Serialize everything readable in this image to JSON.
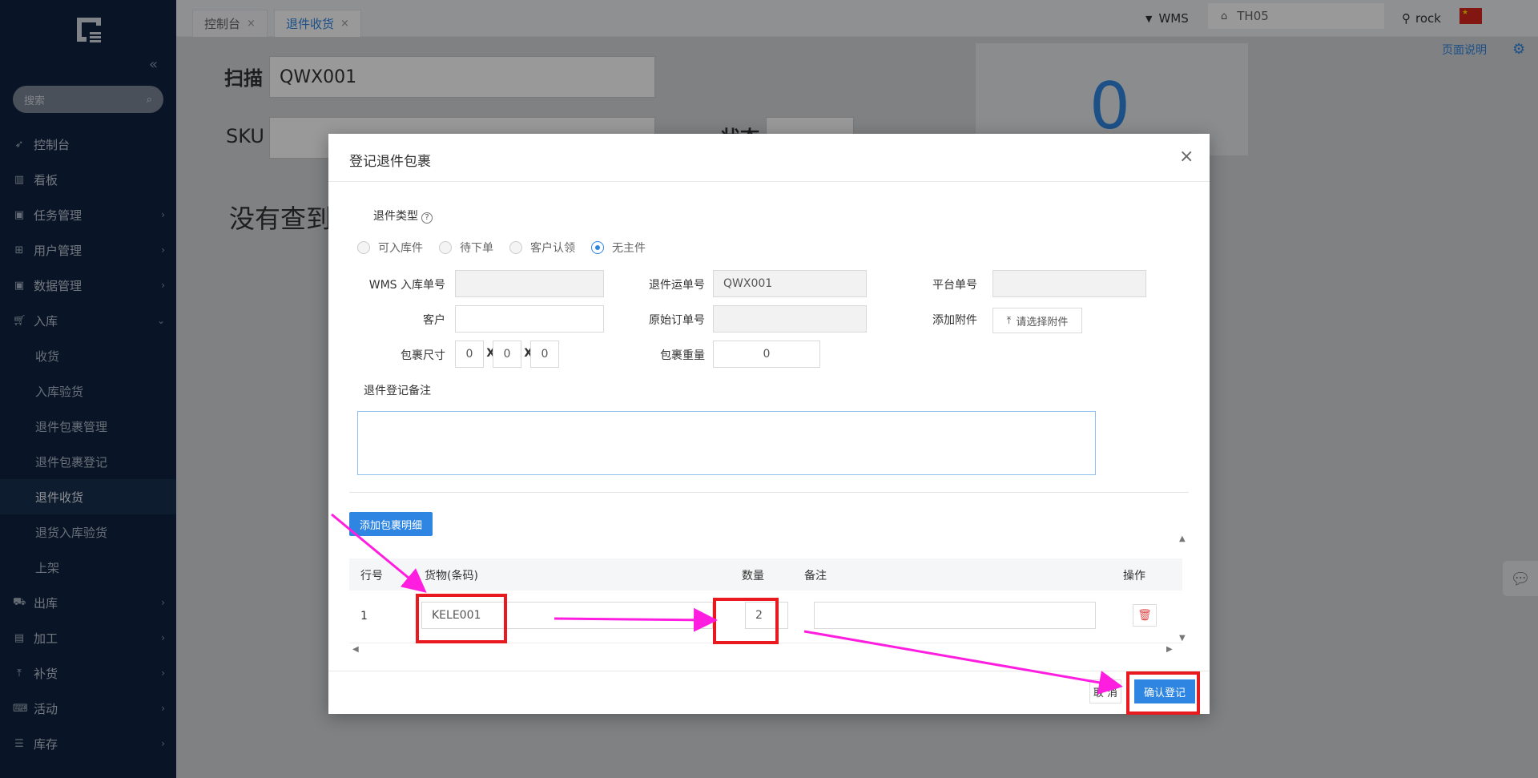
{
  "sidebar": {
    "search_placeholder": "搜索",
    "items": [
      {
        "label": "控制台"
      },
      {
        "label": "看板"
      },
      {
        "label": "任务管理"
      },
      {
        "label": "用户管理"
      },
      {
        "label": "数据管理"
      },
      {
        "label": "入库"
      },
      {
        "label": "出库"
      },
      {
        "label": "加工"
      },
      {
        "label": "补货"
      },
      {
        "label": "活动"
      },
      {
        "label": "库存"
      }
    ],
    "inbound_sub": [
      {
        "label": "收货"
      },
      {
        "label": "入库验货"
      },
      {
        "label": "退件包裹管理"
      },
      {
        "label": "退件包裹登记"
      },
      {
        "label": "退件收货"
      },
      {
        "label": "退货入库验货"
      },
      {
        "label": "上架"
      }
    ]
  },
  "tabs": [
    {
      "label": "控制台",
      "close": "×"
    },
    {
      "label": "退件收货",
      "close": "×"
    }
  ],
  "topbar": {
    "system": "WMS",
    "warehouse": "TH05",
    "user": "rock",
    "flag_star": "★"
  },
  "page": {
    "help_link": "页面说明",
    "scan_label": "扫描",
    "scan_value": "QWX001",
    "sku_label": "SKU",
    "status_label": "状态",
    "count": "0",
    "no_result": "没有查到"
  },
  "modal": {
    "title": "登记退件包裹",
    "close": "×",
    "return_type_label": "退件类型",
    "help_mark": "?",
    "return_types": [
      {
        "label": "可入库件"
      },
      {
        "label": "待下单"
      },
      {
        "label": "客户认领"
      },
      {
        "label": "无主件"
      }
    ],
    "wms_inbound_label": "WMS 入库单号",
    "wms_inbound_value": "",
    "tracking_label": "退件运单号",
    "tracking_value": "QWX001",
    "platform_label": "平台单号",
    "platform_value": "",
    "customer_label": "客户",
    "customer_value": "",
    "original_order_label": "原始订单号",
    "original_order_value": "",
    "attachment_label": "添加附件",
    "attachment_button": "请选择附件",
    "size_label": "包裹尺寸",
    "size_l": "0",
    "size_w": "0",
    "size_h": "0",
    "size_sep": "X",
    "weight_label": "包裹重量",
    "weight_value": "0",
    "remark_label": "退件登记备注",
    "remark_value": "",
    "add_detail_button": "添加包裹明细",
    "table": {
      "headers": {
        "row": "行号",
        "goods": "货物(条码)",
        "qty": "数量",
        "note": "备注",
        "ops": "操作"
      },
      "rows": [
        {
          "num": "1",
          "goods": "KELE001",
          "qty": "2",
          "note": ""
        }
      ]
    },
    "cancel_button": "取 消",
    "confirm_button": "确认登记"
  }
}
